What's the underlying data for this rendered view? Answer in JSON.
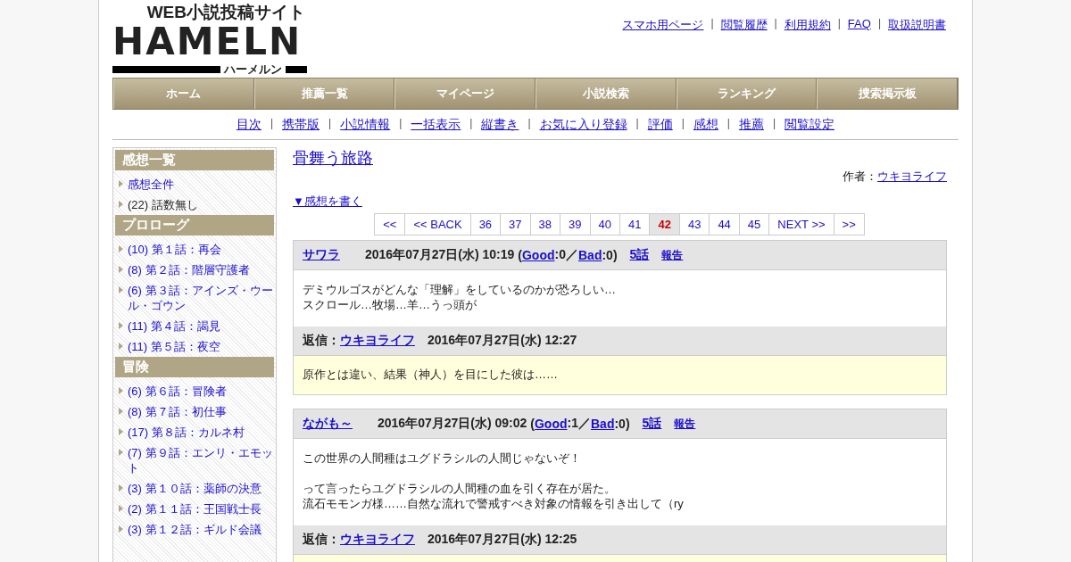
{
  "logo": {
    "tagline": "WEB小説投稿サイト",
    "wordmark": "HAMELN",
    "reading": "ハーメルン"
  },
  "top_links": [
    {
      "label": "スマホ用ページ"
    },
    {
      "sep": "|",
      "label": "閲覧履歴"
    },
    {
      "sep": "|",
      "label": "利用規約"
    },
    {
      "sep": "|",
      "label": "FAQ"
    },
    {
      "sep": "|",
      "label": "取扱説明書"
    }
  ],
  "nav": [
    "ホーム",
    "推薦一覧",
    "マイページ",
    "小説検索",
    "ランキング",
    "捜索掲示板"
  ],
  "sub_links": [
    {
      "label": "目次"
    },
    {
      "sep": "|",
      "label": "携帯版"
    },
    {
      "sep": "|",
      "label": "小説情報"
    },
    {
      "sep": "|",
      "label": "一括表示"
    },
    {
      "sep": "|",
      "label": "縦書き"
    },
    {
      "sep": "|",
      "label": "お気に入り登録"
    },
    {
      "sep": "|",
      "label": "評価"
    },
    {
      "sep": "|",
      "label": "感想"
    },
    {
      "sep": "|",
      "label": "推薦"
    },
    {
      "sep": "|",
      "label": "閲覧設定"
    }
  ],
  "sidebar": [
    {
      "heading": "感想一覧",
      "items": [
        {
          "label": "感想全件",
          "kind": "link"
        },
        {
          "label": "(22) 話数無し",
          "kind": "text"
        }
      ]
    },
    {
      "heading": "プロローグ",
      "items": [
        {
          "label": "(10) 第１話：再会",
          "kind": "link"
        },
        {
          "label": "(8) 第２話：階層守護者",
          "kind": "link"
        },
        {
          "label": "(6) 第３話：アインズ・ウール・ゴウン",
          "kind": "link"
        },
        {
          "label": "(11) 第４話：謁見",
          "kind": "link"
        },
        {
          "label": "(11) 第５話：夜空",
          "kind": "link"
        }
      ]
    },
    {
      "heading": "冒険",
      "items": [
        {
          "label": "(6) 第６話：冒険者",
          "kind": "link"
        },
        {
          "label": "(8) 第７話：初仕事",
          "kind": "link"
        },
        {
          "label": "(17) 第８話：カルネ村",
          "kind": "link"
        },
        {
          "label": "(7) 第９話：エンリ・エモット",
          "kind": "link"
        },
        {
          "label": "(3) 第１０話：薬師の決意",
          "kind": "link"
        },
        {
          "label": "(2) 第１１話：王国戦士長",
          "kind": "link"
        },
        {
          "label": "(3) 第１２話：ギルド会議",
          "kind": "link"
        }
      ]
    }
  ],
  "novel": {
    "title": "骨舞う旅路",
    "author_label": "作者：",
    "author": "ウキヨライフ",
    "write_link": "▼感想を書く"
  },
  "pagination": [
    {
      "label": "<<",
      "selected": false
    },
    {
      "label": "<< BACK",
      "selected": false
    },
    {
      "label": "36",
      "selected": false
    },
    {
      "label": "37",
      "selected": false
    },
    {
      "label": "38",
      "selected": false
    },
    {
      "label": "39",
      "selected": false
    },
    {
      "label": "40",
      "selected": false
    },
    {
      "label": "41",
      "selected": false
    },
    {
      "label": "42",
      "selected": true
    },
    {
      "label": "43",
      "selected": false
    },
    {
      "label": "44",
      "selected": false
    },
    {
      "label": "45",
      "selected": false
    },
    {
      "label": "NEXT >>",
      "selected": false
    },
    {
      "label": ">>",
      "selected": false
    }
  ],
  "comments": [
    {
      "user": "サワラ",
      "date": "2016年07月27日(水) 10:19",
      "rating": [
        {
          "text": "(",
          "kind": "text"
        },
        {
          "text": "Good",
          "kind": "link"
        },
        {
          "text": ":0／",
          "kind": "text"
        },
        {
          "text": "Bad",
          "kind": "link"
        },
        {
          "text": ":0)",
          "kind": "text"
        }
      ],
      "episode": "5話",
      "report": "報告",
      "body": [
        [
          "デミウルゴスがどんな「理解」をしているのかが恐ろしい…",
          "スクロール…牧場…羊…うっ頭が"
        ]
      ],
      "reply_label": "返信：",
      "reply_user": "ウキヨライフ",
      "reply_date": "2016年07月27日(水) 12:27",
      "reply_body": [
        [
          "原作とは違い、結果（神人）を目にした彼は……"
        ]
      ]
    },
    {
      "user": "ながも～",
      "date": "2016年07月27日(水) 09:02",
      "rating": [
        {
          "text": "(",
          "kind": "text"
        },
        {
          "text": "Good",
          "kind": "link"
        },
        {
          "text": ":1／",
          "kind": "text"
        },
        {
          "text": "Bad",
          "kind": "link"
        },
        {
          "text": ":0)",
          "kind": "text"
        }
      ],
      "episode": "5話",
      "report": "報告",
      "body": [
        [
          "この世界の人間種はユグドラシルの人間じゃないぞ！"
        ],
        [
          "って言ったらユグドラシルの人間種の血を引く存在が居た。",
          "流石モモンガ様……自然な流れで警戒すべき対象の情報を引き出して（ry"
        ]
      ],
      "reply_label": "返信：",
      "reply_user": "ウキヨライフ",
      "reply_date": "2016年07月27日(水) 12:25"
    }
  ]
}
